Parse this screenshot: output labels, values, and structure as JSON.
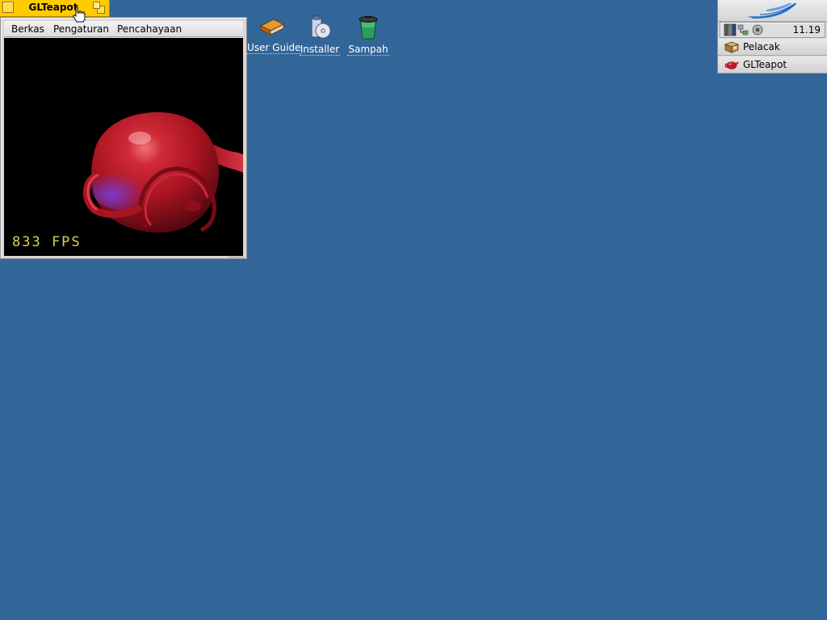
{
  "window": {
    "title": "GLTeapot",
    "menu": [
      "Berkas",
      "Pengaturan",
      "Pencahayaan"
    ],
    "fps_text": "833 FPS"
  },
  "desktop": {
    "background_color": "#336698",
    "icons": [
      {
        "label": "User Guide",
        "icon": "book-icon"
      },
      {
        "label": "Installer",
        "icon": "installer-icon"
      },
      {
        "label": "Sampah",
        "icon": "trash-icon"
      }
    ]
  },
  "deskbar": {
    "clock": "11.19",
    "items": [
      {
        "label": "Pelacak",
        "icon": "tracker-icon"
      },
      {
        "label": "GLTeapot",
        "icon": "teapot-icon"
      }
    ]
  },
  "colors": {
    "window_tab": "#ffcb00",
    "teapot": "#b01828",
    "fps_text": "#d8d24f"
  }
}
